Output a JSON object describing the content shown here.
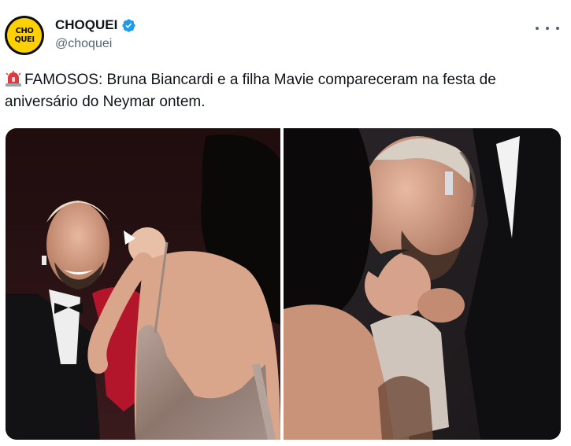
{
  "author": {
    "avatar_text": [
      "CHO",
      "QUEI"
    ],
    "display_name": "CHOQUEI",
    "handle": "@choquei",
    "verified": true
  },
  "tweet": {
    "emoji": "siren-icon",
    "text": "FAMOSOS: Bruna Biancardi e a filha Mavie compareceram na festa de aniversário do Neymar ontem."
  },
  "media": {
    "count": 2
  },
  "colors": {
    "verified_blue": "#1d9bf0",
    "avatar_yellow": "#ffd100",
    "secondary_text": "#536471"
  }
}
